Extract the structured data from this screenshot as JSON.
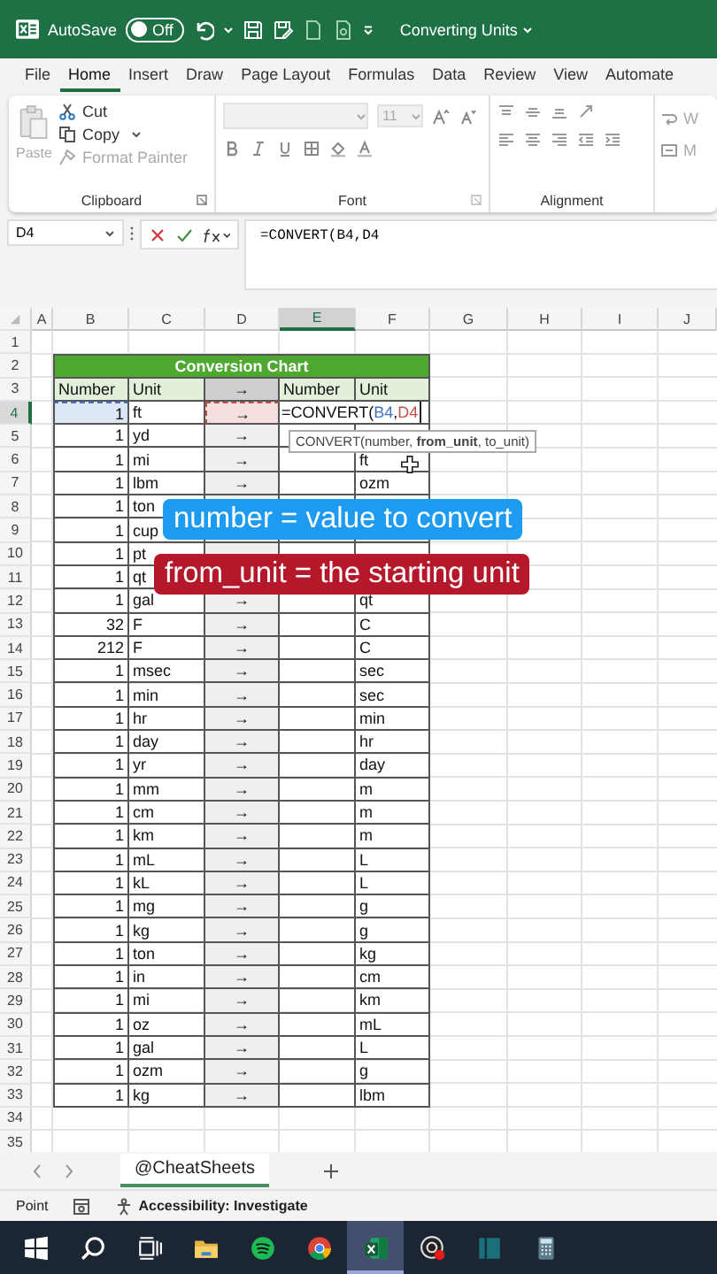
{
  "title_bar": {
    "autosave_label": "AutoSave",
    "autosave": {
      "on": false,
      "label": "Off"
    },
    "document_title": "Converting Units"
  },
  "menu_tabs": [
    {
      "label": "File",
      "selected": false
    },
    {
      "label": "Home",
      "selected": true
    },
    {
      "label": "Insert",
      "selected": false
    },
    {
      "label": "Draw",
      "selected": false
    },
    {
      "label": "Page Layout",
      "selected": false
    },
    {
      "label": "Formulas",
      "selected": false
    },
    {
      "label": "Data",
      "selected": false
    },
    {
      "label": "Review",
      "selected": false
    },
    {
      "label": "View",
      "selected": false
    },
    {
      "label": "Automate",
      "selected": false
    }
  ],
  "ribbon": {
    "clipboard": {
      "paste": "Paste",
      "cut": "Cut",
      "copy": "Copy",
      "format_painter": "Format Painter",
      "label": "Clipboard"
    },
    "font": {
      "size": "11",
      "label": "Font"
    },
    "alignment": {
      "wrap": "W",
      "merge": "M",
      "label": "Alignment"
    }
  },
  "formula_bar": {
    "name_box": "D4",
    "formula": "=CONVERT(B4,D4"
  },
  "columns": [
    {
      "label": "A",
      "selected": false
    },
    {
      "label": "B",
      "selected": false
    },
    {
      "label": "C",
      "selected": false
    },
    {
      "label": "D",
      "selected": false
    },
    {
      "label": "E",
      "selected": true
    },
    {
      "label": "F",
      "selected": false
    },
    {
      "label": "G",
      "selected": false
    },
    {
      "label": "H",
      "selected": false
    },
    {
      "label": "I",
      "selected": false
    },
    {
      "label": "J",
      "selected": false
    }
  ],
  "rows": [
    {
      "label": "1",
      "selected": false
    },
    {
      "label": "2",
      "selected": false
    },
    {
      "label": "3",
      "selected": false
    },
    {
      "label": "4",
      "selected": true
    },
    {
      "label": "5",
      "selected": false
    },
    {
      "label": "6",
      "selected": false
    },
    {
      "label": "7",
      "selected": false
    },
    {
      "label": "8",
      "selected": false
    },
    {
      "label": "9",
      "selected": false
    },
    {
      "label": "10",
      "selected": false
    },
    {
      "label": "11",
      "selected": false
    },
    {
      "label": "12",
      "selected": false
    },
    {
      "label": "13",
      "selected": false
    },
    {
      "label": "14",
      "selected": false
    },
    {
      "label": "15",
      "selected": false
    },
    {
      "label": "16",
      "selected": false
    },
    {
      "label": "17",
      "selected": false
    },
    {
      "label": "18",
      "selected": false
    },
    {
      "label": "19",
      "selected": false
    },
    {
      "label": "20",
      "selected": false
    },
    {
      "label": "21",
      "selected": false
    },
    {
      "label": "22",
      "selected": false
    },
    {
      "label": "23",
      "selected": false
    },
    {
      "label": "24",
      "selected": false
    },
    {
      "label": "25",
      "selected": false
    },
    {
      "label": "26",
      "selected": false
    },
    {
      "label": "27",
      "selected": false
    },
    {
      "label": "28",
      "selected": false
    },
    {
      "label": "29",
      "selected": false
    },
    {
      "label": "30",
      "selected": false
    },
    {
      "label": "31",
      "selected": false
    },
    {
      "label": "32",
      "selected": false
    },
    {
      "label": "33",
      "selected": false
    },
    {
      "label": "34",
      "selected": false
    },
    {
      "label": "35",
      "selected": false
    }
  ],
  "chart": {
    "title": "Conversion Chart",
    "headers": [
      "Number",
      "Unit",
      "→",
      "Number",
      "Unit"
    ],
    "rows": [
      {
        "number": "1",
        "unit": "ft",
        "arrow": "→",
        "referenced": true,
        "edit_parts": [
          {
            "text": "=CONVERT(",
            "ref": "B4",
            "color": "#4472c4"
          },
          {
            "text": ",",
            "ref": "D4",
            "color": "#c0504d"
          }
        ]
      },
      {
        "number": "1",
        "unit": "yd",
        "arrow": "→",
        "referenced": false
      },
      {
        "number": "1",
        "unit": "mi",
        "arrow": "→",
        "to_unit": "ft",
        "referenced": false
      },
      {
        "number": "1",
        "unit": "lbm",
        "arrow": "→",
        "to_unit": "ozm",
        "referenced": false
      },
      {
        "number": "1",
        "unit": "ton",
        "referenced": false
      },
      {
        "number": "1",
        "unit": "cup",
        "referenced": false
      },
      {
        "number": "1",
        "unit": "pt",
        "referenced": false
      },
      {
        "number": "1",
        "unit": "qt",
        "referenced": false
      },
      {
        "number": "1",
        "unit": "gal",
        "arrow": "→",
        "to_unit": "qt",
        "referenced": false
      },
      {
        "number": "32",
        "unit": "F",
        "arrow": "→",
        "to_unit": "C",
        "referenced": false
      },
      {
        "number": "212",
        "unit": "F",
        "arrow": "→",
        "to_unit": "C",
        "referenced": false
      },
      {
        "number": "1",
        "unit": "msec",
        "arrow": "→",
        "to_unit": "sec",
        "referenced": false
      },
      {
        "number": "1",
        "unit": "min",
        "arrow": "→",
        "to_unit": "sec",
        "referenced": false
      },
      {
        "number": "1",
        "unit": "hr",
        "arrow": "→",
        "to_unit": "min",
        "referenced": false
      },
      {
        "number": "1",
        "unit": "day",
        "arrow": "→",
        "to_unit": "hr",
        "referenced": false
      },
      {
        "number": "1",
        "unit": "yr",
        "arrow": "→",
        "to_unit": "day",
        "referenced": false
      },
      {
        "number": "1",
        "unit": "mm",
        "arrow": "→",
        "to_unit": "m",
        "referenced": false
      },
      {
        "number": "1",
        "unit": "cm",
        "arrow": "→",
        "to_unit": "m",
        "referenced": false
      },
      {
        "number": "1",
        "unit": "km",
        "arrow": "→",
        "to_unit": "m",
        "referenced": false
      },
      {
        "number": "1",
        "unit": "mL",
        "arrow": "→",
        "to_unit": "L",
        "referenced": false
      },
      {
        "number": "1",
        "unit": "kL",
        "arrow": "→",
        "to_unit": "L",
        "referenced": false
      },
      {
        "number": "1",
        "unit": "mg",
        "arrow": "→",
        "to_unit": "g",
        "referenced": false
      },
      {
        "number": "1",
        "unit": "kg",
        "arrow": "→",
        "to_unit": "g",
        "referenced": false
      },
      {
        "number": "1",
        "unit": "ton",
        "arrow": "→",
        "to_unit": "kg",
        "referenced": false
      },
      {
        "number": "1",
        "unit": "in",
        "arrow": "→",
        "to_unit": "cm",
        "referenced": false
      },
      {
        "number": "1",
        "unit": "mi",
        "arrow": "→",
        "to_unit": "km",
        "referenced": false
      },
      {
        "number": "1",
        "unit": "oz",
        "arrow": "→",
        "to_unit": "mL",
        "referenced": false
      },
      {
        "number": "1",
        "unit": "gal",
        "arrow": "→",
        "to_unit": "L",
        "referenced": false
      },
      {
        "number": "1",
        "unit": "ozm",
        "arrow": "→",
        "to_unit": "g",
        "referenced": false
      },
      {
        "number": "1",
        "unit": "kg",
        "arrow": "→",
        "to_unit": "lbm",
        "referenced": false
      }
    ]
  },
  "tooltip": "CONVERT(number, **from_unit**, to_unit)",
  "captions": [
    {
      "text": "number = value to convert",
      "color": "#1c9bf0"
    },
    {
      "text": "from_unit = the starting unit",
      "color": "#b5182b"
    }
  ],
  "sheet_tabs": [
    {
      "label": "@CheatSheets",
      "selected": true
    }
  ],
  "status_bar": {
    "mode": "Point",
    "accessibility": "Accessibility: Investigate"
  },
  "taskbar": [
    {
      "kind": "start",
      "selected": false
    },
    {
      "kind": "search",
      "selected": false
    },
    {
      "kind": "taskview",
      "selected": false
    },
    {
      "kind": "folder",
      "selected": false
    },
    {
      "kind": "spotify",
      "selected": false
    },
    {
      "kind": "chrome",
      "selected": false
    },
    {
      "kind": "excel",
      "selected": true
    },
    {
      "kind": "recorder",
      "selected": false
    },
    {
      "kind": "panel",
      "selected": false
    },
    {
      "kind": "calculator",
      "selected": false
    }
  ]
}
